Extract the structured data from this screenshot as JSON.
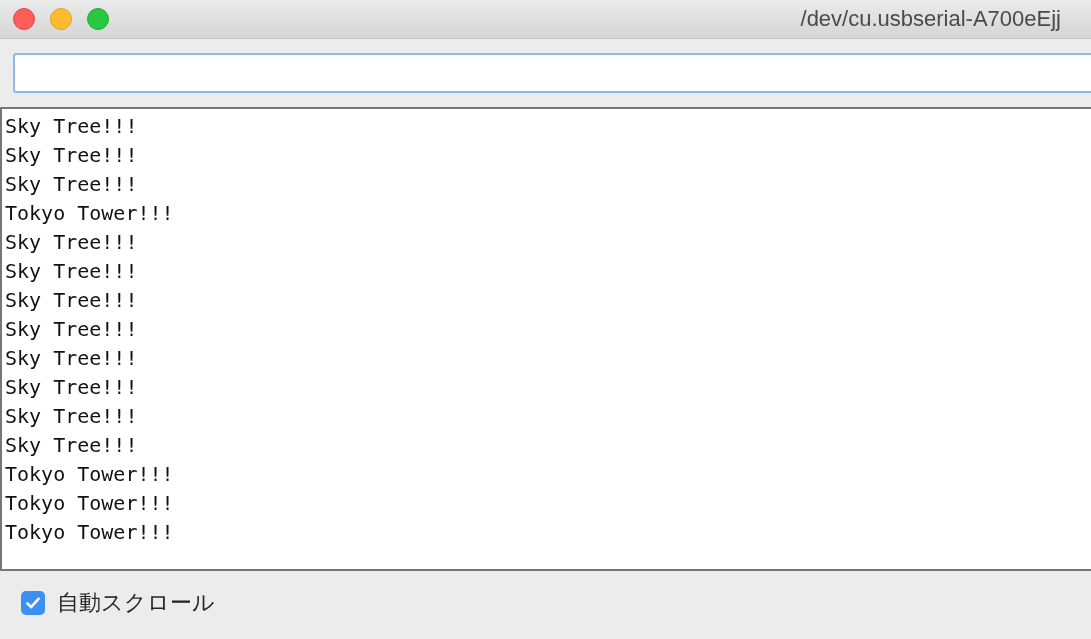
{
  "window": {
    "title": "/dev/cu.usbserial-A700eEjj"
  },
  "output": {
    "lines": [
      "Sky Tree!!!",
      "Sky Tree!!!",
      "Sky Tree!!!",
      "Tokyo Tower!!!",
      "Sky Tree!!!",
      "Sky Tree!!!",
      "Sky Tree!!!",
      "Sky Tree!!!",
      "Sky Tree!!!",
      "Sky Tree!!!",
      "Sky Tree!!!",
      "Sky Tree!!!",
      "Tokyo Tower!!!",
      "Tokyo Tower!!!",
      "Tokyo Tower!!!"
    ]
  },
  "autoscroll": {
    "label": "自動スクロール",
    "checked": true
  }
}
